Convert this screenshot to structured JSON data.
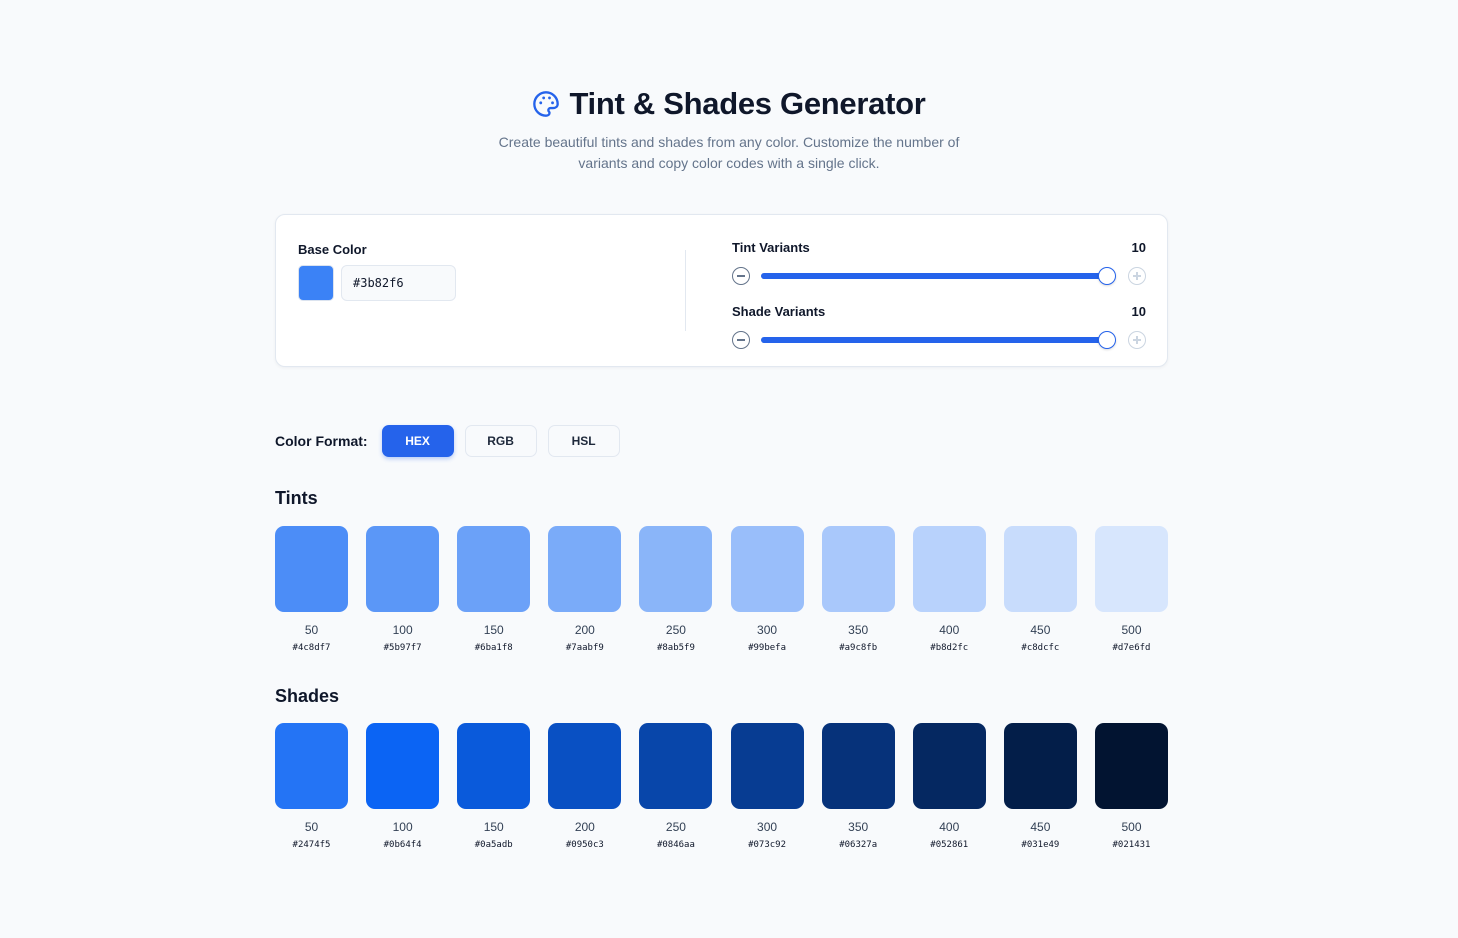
{
  "header": {
    "title": "Tint & Shades Generator",
    "subtitle": "Create beautiful tints and shades from any color. Customize the number of variants and copy color codes with a single click.",
    "icon": "palette-icon",
    "icon_color": "#2563eb"
  },
  "controls": {
    "base_label": "Base Color",
    "base_value": "#3b82f6",
    "tint": {
      "label": "Tint Variants",
      "value": "10",
      "min": 1,
      "max": 10
    },
    "shade": {
      "label": "Shade Variants",
      "value": "10",
      "min": 1,
      "max": 10
    }
  },
  "format": {
    "label": "Color Format:",
    "options": [
      "HEX",
      "RGB",
      "HSL"
    ],
    "selected": "HEX"
  },
  "colors": {
    "accent": "#2563eb"
  },
  "tints": {
    "title": "Tints",
    "items": [
      {
        "label": "50",
        "hex": "#4c8df7"
      },
      {
        "label": "100",
        "hex": "#5b97f7"
      },
      {
        "label": "150",
        "hex": "#6ba1f8"
      },
      {
        "label": "200",
        "hex": "#7aabf9"
      },
      {
        "label": "250",
        "hex": "#8ab5f9"
      },
      {
        "label": "300",
        "hex": "#99befa"
      },
      {
        "label": "350",
        "hex": "#a9c8fb"
      },
      {
        "label": "400",
        "hex": "#b8d2fc"
      },
      {
        "label": "450",
        "hex": "#c8dcfc"
      },
      {
        "label": "500",
        "hex": "#d7e6fd"
      }
    ]
  },
  "shades": {
    "title": "Shades",
    "items": [
      {
        "label": "50",
        "hex": "#2474f5"
      },
      {
        "label": "100",
        "hex": "#0b64f4"
      },
      {
        "label": "150",
        "hex": "#0a5adb"
      },
      {
        "label": "200",
        "hex": "#0950c3"
      },
      {
        "label": "250",
        "hex": "#0846aa"
      },
      {
        "label": "300",
        "hex": "#073c92"
      },
      {
        "label": "350",
        "hex": "#06327a"
      },
      {
        "label": "400",
        "hex": "#052861"
      },
      {
        "label": "450",
        "hex": "#031e49"
      },
      {
        "label": "500",
        "hex": "#021431"
      }
    ]
  }
}
